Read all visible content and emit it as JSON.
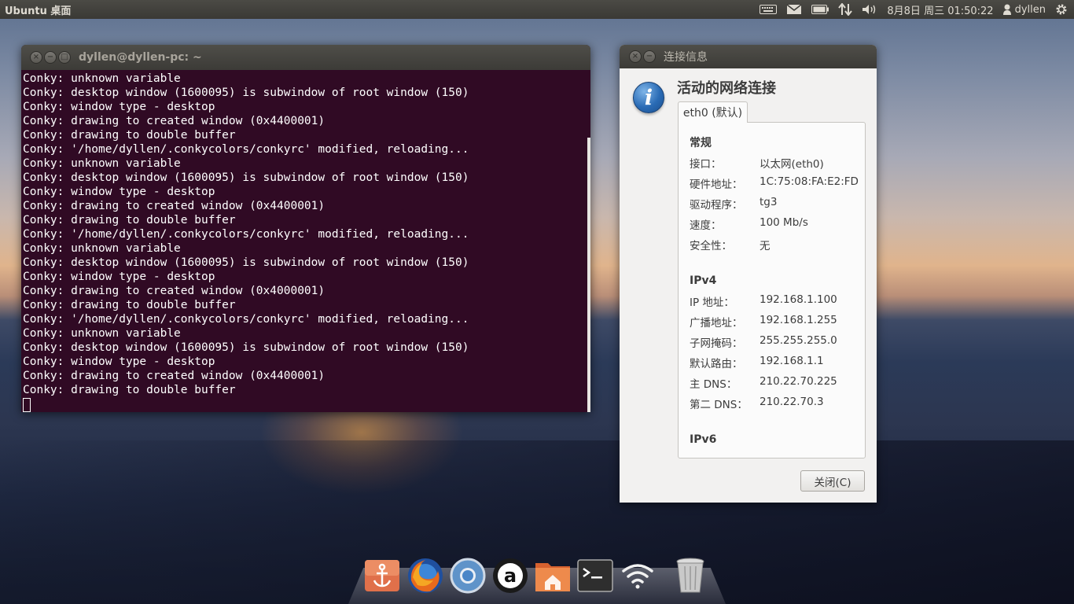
{
  "top_panel": {
    "title": "Ubuntu 桌面",
    "clock": "8月8日 周三 01:50:22",
    "user": "dyllen",
    "indicators": [
      "keyboard-icon",
      "mail-icon",
      "battery-icon",
      "network-arrows-icon",
      "volume-icon",
      "user-icon",
      "gear-icon"
    ]
  },
  "terminal": {
    "title": "dyllen@dyllen-pc: ~",
    "lines": [
      "Conky: unknown variable",
      "Conky: desktop window (1600095) is subwindow of root window (150)",
      "Conky: window type - desktop",
      "Conky: drawing to created window (0x4400001)",
      "Conky: drawing to double buffer",
      "Conky: '/home/dyllen/.conkycolors/conkyrc' modified, reloading...",
      "Conky: unknown variable",
      "Conky: desktop window (1600095) is subwindow of root window (150)",
      "Conky: window type - desktop",
      "Conky: drawing to created window (0x4400001)",
      "Conky: drawing to double buffer",
      "Conky: '/home/dyllen/.conkycolors/conkyrc' modified, reloading...",
      "Conky: unknown variable",
      "Conky: desktop window (1600095) is subwindow of root window (150)",
      "Conky: window type - desktop",
      "Conky: drawing to created window (0x4000001)",
      "Conky: drawing to double buffer",
      "Conky: '/home/dyllen/.conkycolors/conkyrc' modified, reloading...",
      "Conky: unknown variable",
      "Conky: desktop window (1600095) is subwindow of root window (150)",
      "Conky: window type - desktop",
      "Conky: drawing to created window (0x4400001)",
      "Conky: drawing to double buffer"
    ]
  },
  "dialog": {
    "title": "连接信息",
    "heading": "活动的网络连接",
    "tab_label": "eth0 (默认)",
    "general": {
      "title": "常规",
      "rows": [
        {
          "key": "接口：",
          "value": "以太网(eth0)"
        },
        {
          "key": "硬件地址：",
          "value": "1C:75:08:FA:E2:FD"
        },
        {
          "key": "驱动程序：",
          "value": "tg3"
        },
        {
          "key": "速度：",
          "value": "100 Mb/s"
        },
        {
          "key": "安全性：",
          "value": "无"
        }
      ]
    },
    "ipv4": {
      "title": "IPv4",
      "rows": [
        {
          "key": "IP 地址：",
          "value": "192.168.1.100"
        },
        {
          "key": "广播地址：",
          "value": "192.168.1.255"
        },
        {
          "key": "子网掩码：",
          "value": "255.255.255.0"
        },
        {
          "key": "默认路由：",
          "value": "192.168.1.1"
        },
        {
          "key": "主 DNS：",
          "value": "210.22.70.225"
        },
        {
          "key": "第二 DNS：",
          "value": "210.22.70.3"
        }
      ]
    },
    "ipv6": {
      "title": "IPv6"
    },
    "close_label": "关闭(C)"
  },
  "dock": {
    "items": [
      "anchor-icon",
      "firefox-icon",
      "chromium-icon",
      "amazon-icon",
      "home-folder-icon",
      "terminal-icon",
      "wifi-icon",
      "trash-icon"
    ]
  },
  "colors": {
    "terminal_bg": "#300a24",
    "panel_bg": "#3c3b37",
    "dialog_bg": "#f2f1f0",
    "info_blue": "#2a6bb5"
  }
}
